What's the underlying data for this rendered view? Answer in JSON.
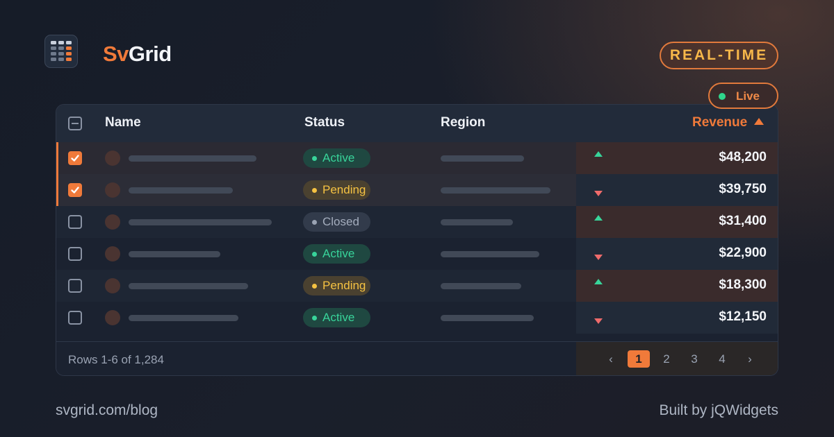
{
  "brand": {
    "name_prefix": "Sv",
    "name_suffix": "Grid",
    "logo_icon": "spreadsheet-icon"
  },
  "badges": {
    "realtime": "REAL-TIME",
    "live": "Live"
  },
  "colors": {
    "accent": "#f07a3a",
    "active": "#38d49a",
    "pending": "#f5c242",
    "closed": "#9aa3b3",
    "trend_up": "#38d49a",
    "trend_down": "#ef6b6b"
  },
  "table": {
    "columns": {
      "name": "Name",
      "status": "Status",
      "region": "Region",
      "revenue": "Revenue"
    },
    "sort": {
      "column": "Revenue",
      "direction": "ascending"
    },
    "rows": [
      {
        "checked": true,
        "status": "Active",
        "trend": "up",
        "revenue": "$48,200"
      },
      {
        "checked": true,
        "status": "Pending",
        "trend": "down",
        "revenue": "$39,750"
      },
      {
        "checked": false,
        "status": "Closed",
        "trend": "up",
        "revenue": "$31,400"
      },
      {
        "checked": false,
        "status": "Active",
        "trend": "down",
        "revenue": "$22,900"
      },
      {
        "checked": false,
        "status": "Pending",
        "trend": "up",
        "revenue": "$18,300"
      },
      {
        "checked": false,
        "status": "Active",
        "trend": "down",
        "revenue": "$12,150"
      }
    ],
    "footer": {
      "info": "Rows 1-6 of 1,284",
      "pager": {
        "prev": "‹",
        "pages": [
          "1",
          "2",
          "3",
          "4"
        ],
        "current": "1",
        "next": "›"
      }
    }
  },
  "footer": {
    "url": "svgrid.com/blog",
    "credit": "Built by jQWidgets"
  }
}
